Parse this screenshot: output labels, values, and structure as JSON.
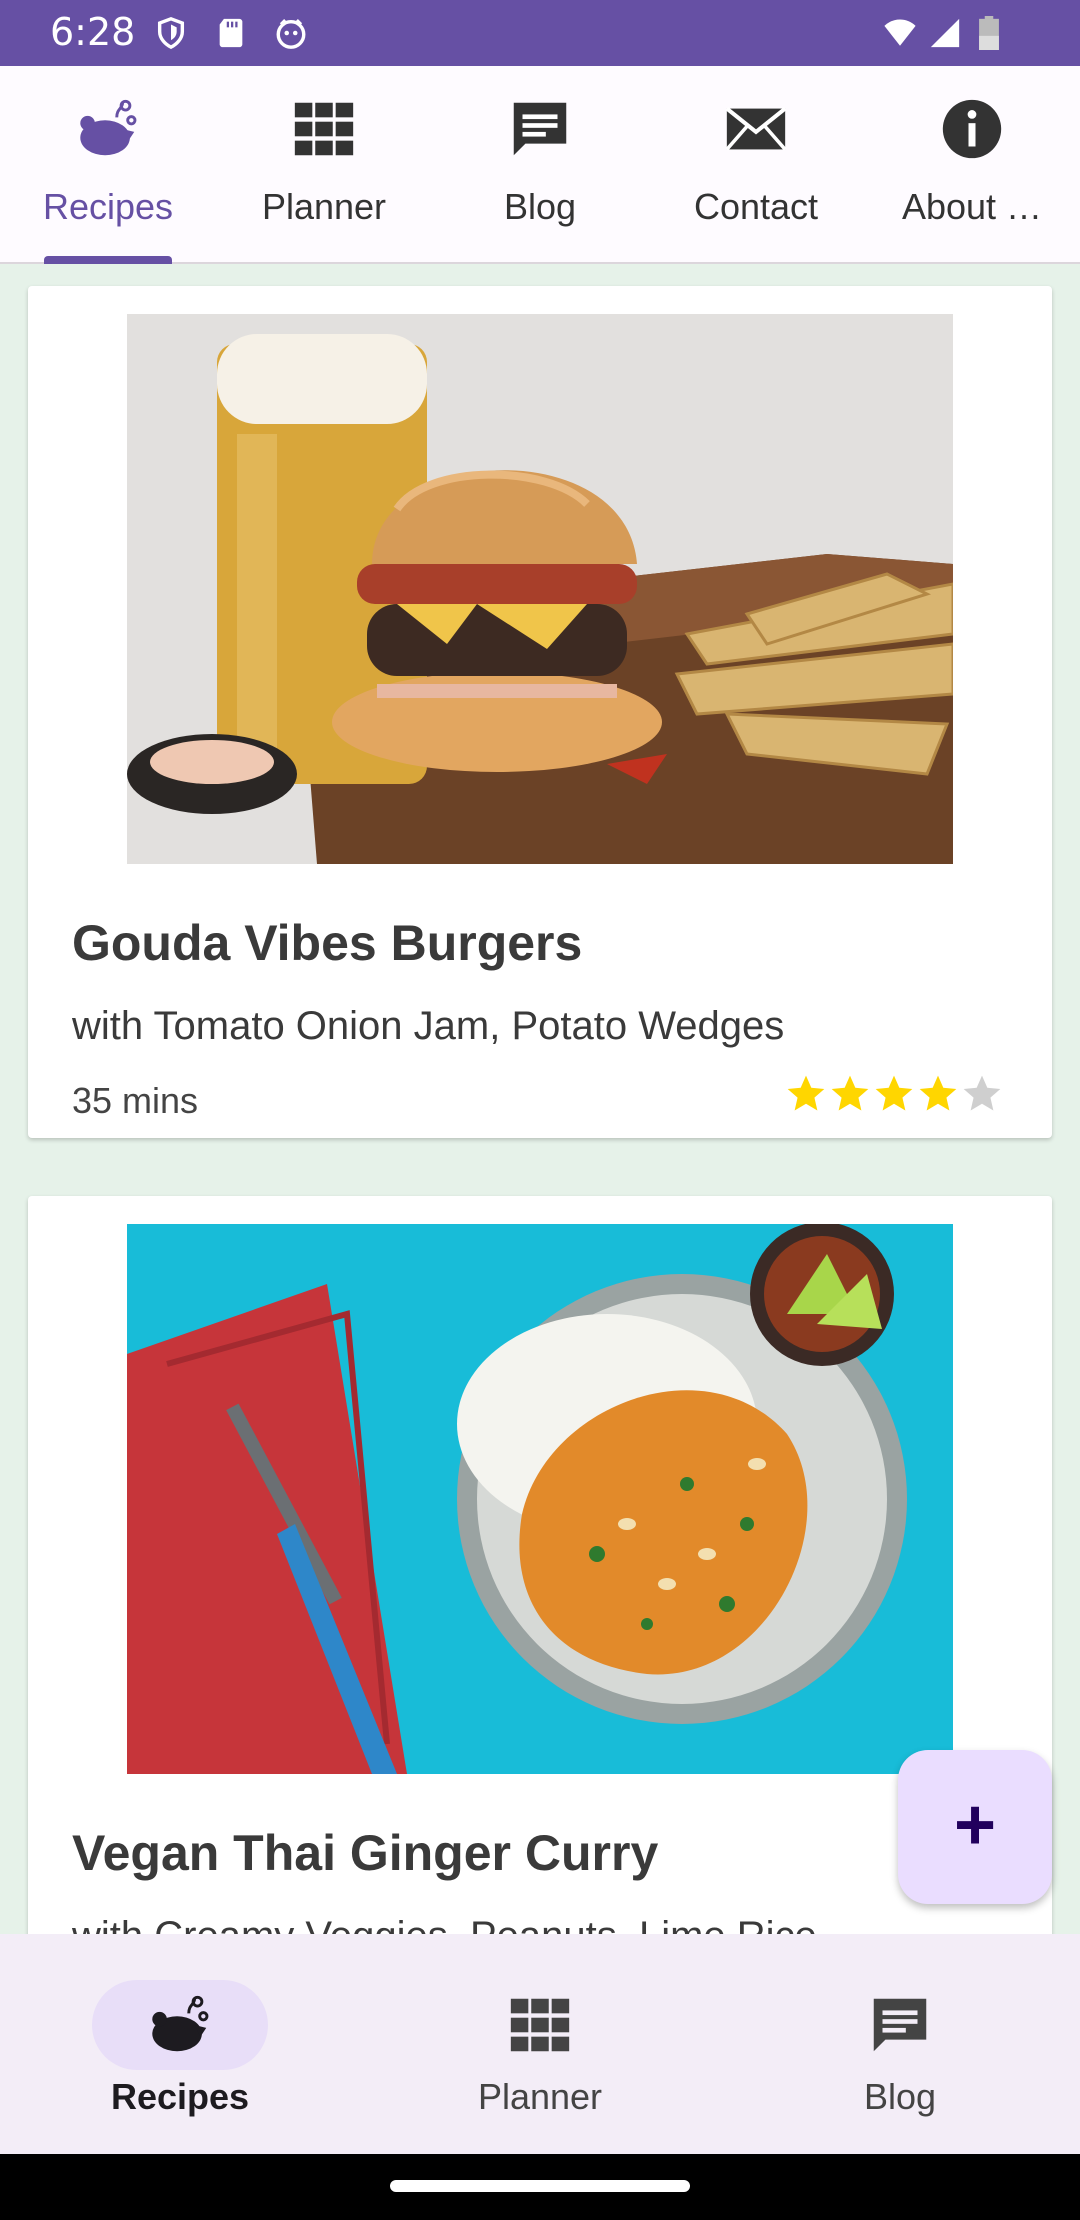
{
  "status_bar": {
    "time": "6:28"
  },
  "top_tabs": [
    {
      "label": "Recipes",
      "icon": "recipes-icon",
      "active": true
    },
    {
      "label": "Planner",
      "icon": "grid-icon",
      "active": false
    },
    {
      "label": "Blog",
      "icon": "chat-icon",
      "active": false
    },
    {
      "label": "Contact",
      "icon": "mail-icon",
      "active": false
    },
    {
      "label": "About …",
      "icon": "info-icon",
      "active": false
    }
  ],
  "recipes": [
    {
      "title": "Gouda Vibes Burgers",
      "subtitle": "with Tomato Onion Jam, Potato Wedges",
      "time": "35 mins",
      "rating": 4,
      "max_rating": 5
    },
    {
      "title": "Vegan Thai Ginger Curry",
      "subtitle": "with Creamy Veggies, Peanuts, Lime Rice"
    }
  ],
  "fab": {
    "label": "+"
  },
  "bottom_nav": [
    {
      "label": "Recipes",
      "icon": "recipes-icon",
      "active": true
    },
    {
      "label": "Planner",
      "icon": "grid-icon",
      "active": false
    },
    {
      "label": "Blog",
      "icon": "chat-icon",
      "active": false
    }
  ],
  "colors": {
    "primary": "#6650a4",
    "star": "#ffd600",
    "star_empty": "#cfcfcf"
  }
}
